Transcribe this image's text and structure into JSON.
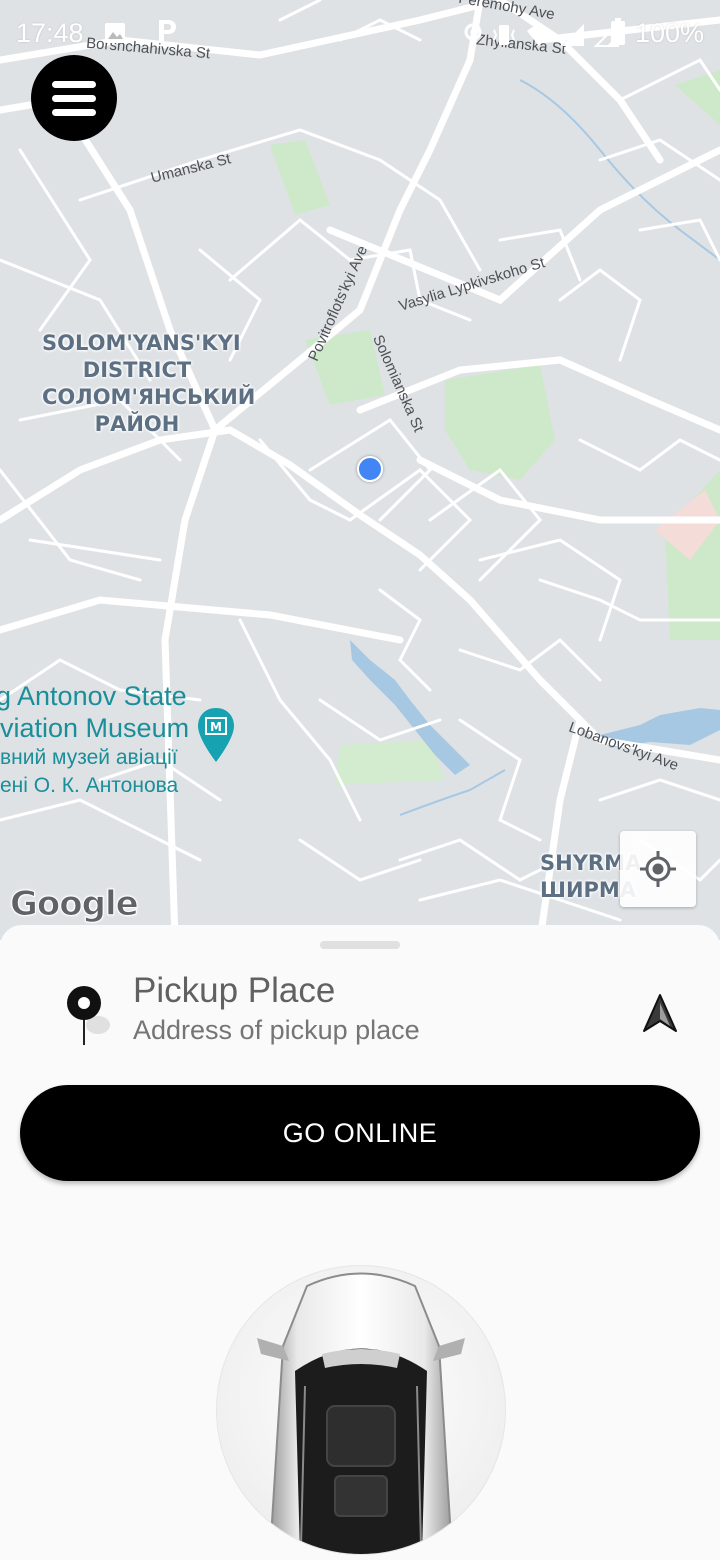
{
  "status_bar": {
    "time": "17:48",
    "battery": "100%",
    "left_icons": [
      "image-icon",
      "parking-icon"
    ],
    "right_icons": [
      "location-icon",
      "vibrate-icon",
      "wifi-icon",
      "signal-icon",
      "signal-icon",
      "battery-icon"
    ]
  },
  "map": {
    "streets": [
      "Peremohy Ave",
      "Zhylianska St",
      "Borshchahivska St",
      "Umanska St",
      "Vasylia Lypkivskoho St",
      "Povitroflots'kyi Ave",
      "Solomianska St",
      "Lobanovs'kyi Ave"
    ],
    "district": {
      "line1": "SOLOM'YANS'KYI",
      "line2": "DISTRICT",
      "line3": "СОЛОМ'ЯНСЬКИЙ",
      "line4": "РАЙОН"
    },
    "poi": {
      "line1": "g Antonov State",
      "line2": "viation Museum",
      "line3": "вний музей авіації",
      "line4": "ені О. К. Антонова"
    },
    "area_label": {
      "line1": "SHYRMA",
      "line2": "ШИРМА"
    },
    "attribution": "Google"
  },
  "sheet": {
    "pickup_title": "Pickup Place",
    "pickup_address": "Address of pickup place",
    "go_online_label": "GO ONLINE"
  },
  "colors": {
    "map_background": "#dfe2e5",
    "road": "#ffffff",
    "park": "#cde9c9",
    "water": "#a7c8e3",
    "user_location": "#4285f4",
    "button": "#000000",
    "button_text": "#ffffff"
  }
}
